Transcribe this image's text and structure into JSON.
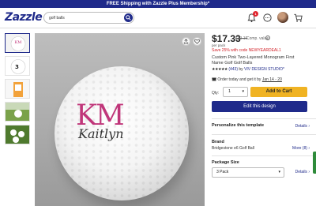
{
  "promo_banner": "FREE Shipping with Zazzle Plus Membership*",
  "header": {
    "logo": "Zazzle",
    "search": {
      "value": "golf balls"
    },
    "notification_count": "1"
  },
  "product": {
    "price": "$17.33",
    "original_price": "$23.10",
    "comp_value_label": "Comp. value",
    "per_pack": "per pack",
    "promo": "Save 25% with code NEWYEARDEAL1",
    "title": "Custom Pink Two-Layered Monogram First Name Golf Golf Balls",
    "stars": "★★★★★",
    "review_count": "(443)",
    "by_label": "by",
    "designer": "VIV DESIGN STUDIO*",
    "order_text": "Order today and get it by",
    "delivery_date": "Jan 14 - 20",
    "image": {
      "monogram": "KM",
      "name": "Kaitlyn"
    }
  },
  "purchase": {
    "qty_label": "Qty:",
    "qty_value": "1",
    "add_to_cart": "Add to Cart",
    "edit_design": "Edit this design"
  },
  "sections": {
    "personalize": {
      "title": "Personalize this template",
      "link": "Details"
    },
    "brand": {
      "title": "Brand",
      "value": "Bridgestone e6 Golf Ball",
      "link": "More (8)"
    },
    "package": {
      "title": "Package Size",
      "selected": "3 Pack",
      "link": "Details"
    }
  },
  "colors": {
    "brand": "#1f2a8a",
    "accent": "#f0b323",
    "promo_red": "#d2232a"
  }
}
